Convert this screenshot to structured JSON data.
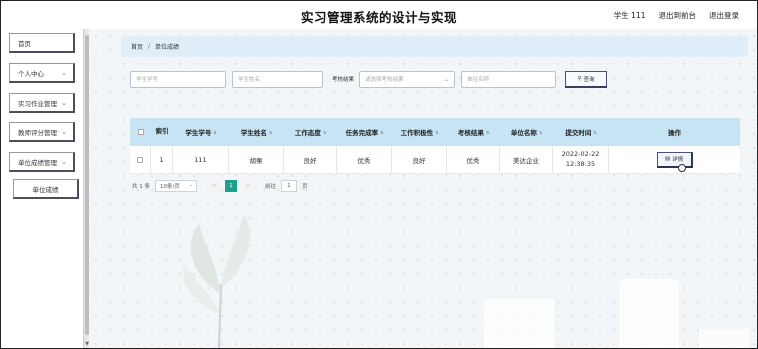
{
  "header": {
    "title": "实习管理系统的设计与实现",
    "user": "学生 111",
    "back_to_front": "退出到前台",
    "logout": "退出登录"
  },
  "sidebar": {
    "items": [
      {
        "label": "首页",
        "has_chevron": false
      },
      {
        "label": "个人中心",
        "has_chevron": true
      },
      {
        "label": "实习作业管理",
        "has_chevron": true
      },
      {
        "label": "教师评分管理",
        "has_chevron": true
      },
      {
        "label": "单位成绩管理",
        "has_chevron": true
      }
    ],
    "sub_item": "单位成绩"
  },
  "breadcrumb": {
    "home": "首页",
    "separator": "/",
    "current": "单位成绩"
  },
  "search": {
    "student_no_placeholder": "学生学号",
    "student_name_placeholder": "学生姓名",
    "result_label": "考核结果",
    "result_placeholder": "请选择考核结果",
    "company_placeholder": "单位名称",
    "search_button": "查询"
  },
  "table": {
    "headers": [
      "索引",
      "学生学号",
      "学生姓名",
      "工作态度",
      "任务完成率",
      "工作积极性",
      "考核结果",
      "单位名称",
      "提交时间",
      "操作"
    ],
    "rows": [
      {
        "index": "1",
        "student_no": "111",
        "student_name": "胡栗",
        "attitude": "良好",
        "completion": "优秀",
        "enthusiasm": "良好",
        "result": "优秀",
        "company": "美达企业",
        "submit_time": "2022-02-22 12:38:35",
        "action": "详情"
      }
    ]
  },
  "pagination": {
    "total": "共 1 条",
    "page_size": "10条/页",
    "prev": "<",
    "current": "1",
    "next": ">",
    "goto_label": "前往",
    "goto_value": "1",
    "page_suffix": "页"
  },
  "colors": {
    "breadcrumb_bg": "#dfeef8",
    "table_header_bg": "#c7e4f4",
    "page_active": "#1aa28f",
    "button_border": "#4b4f7a"
  }
}
